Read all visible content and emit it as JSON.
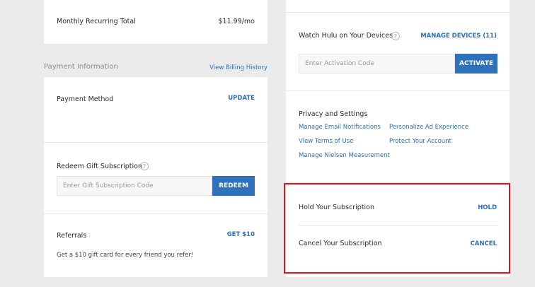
{
  "billing": {
    "monthly_label": "Monthly Recurring Total",
    "monthly_value": "$11.99/mo"
  },
  "payment": {
    "heading": "Payment Information",
    "history_link": "View Billing History",
    "method_label": "Payment Method",
    "update_label": "UPDATE",
    "redeem_label": "Redeem Gift Subscription",
    "redeem_placeholder": "Enter Gift Subscription Code",
    "redeem_button": "REDEEM",
    "referrals_label": "Referrals",
    "get10_label": "GET $10",
    "referrals_text": "Get a $10 gift card for every friend you refer!"
  },
  "devices": {
    "title": "Watch Hulu on Your Devices",
    "manage_link": "MANAGE DEVICES (11)",
    "activation_placeholder": "Enter Activation Code",
    "activate_button": "ACTIVATE"
  },
  "privacy": {
    "title": "Privacy and Settings",
    "links": [
      "Manage Email Notifications",
      "Personalize Ad Experience",
      "View Terms of Use",
      "Protect Your Account",
      "Manage Nielsen Measurement"
    ]
  },
  "subscription": {
    "hold_label": "Hold Your Subscription",
    "hold_action": "HOLD",
    "cancel_label": "Cancel Your Subscription",
    "cancel_action": "CANCEL"
  },
  "icons": {
    "help": "question-mark-icon"
  },
  "colors": {
    "accent": "#2d72bb",
    "link": "#2d6fb8",
    "highlight": "#e0141b",
    "background": "#ebebeb"
  }
}
